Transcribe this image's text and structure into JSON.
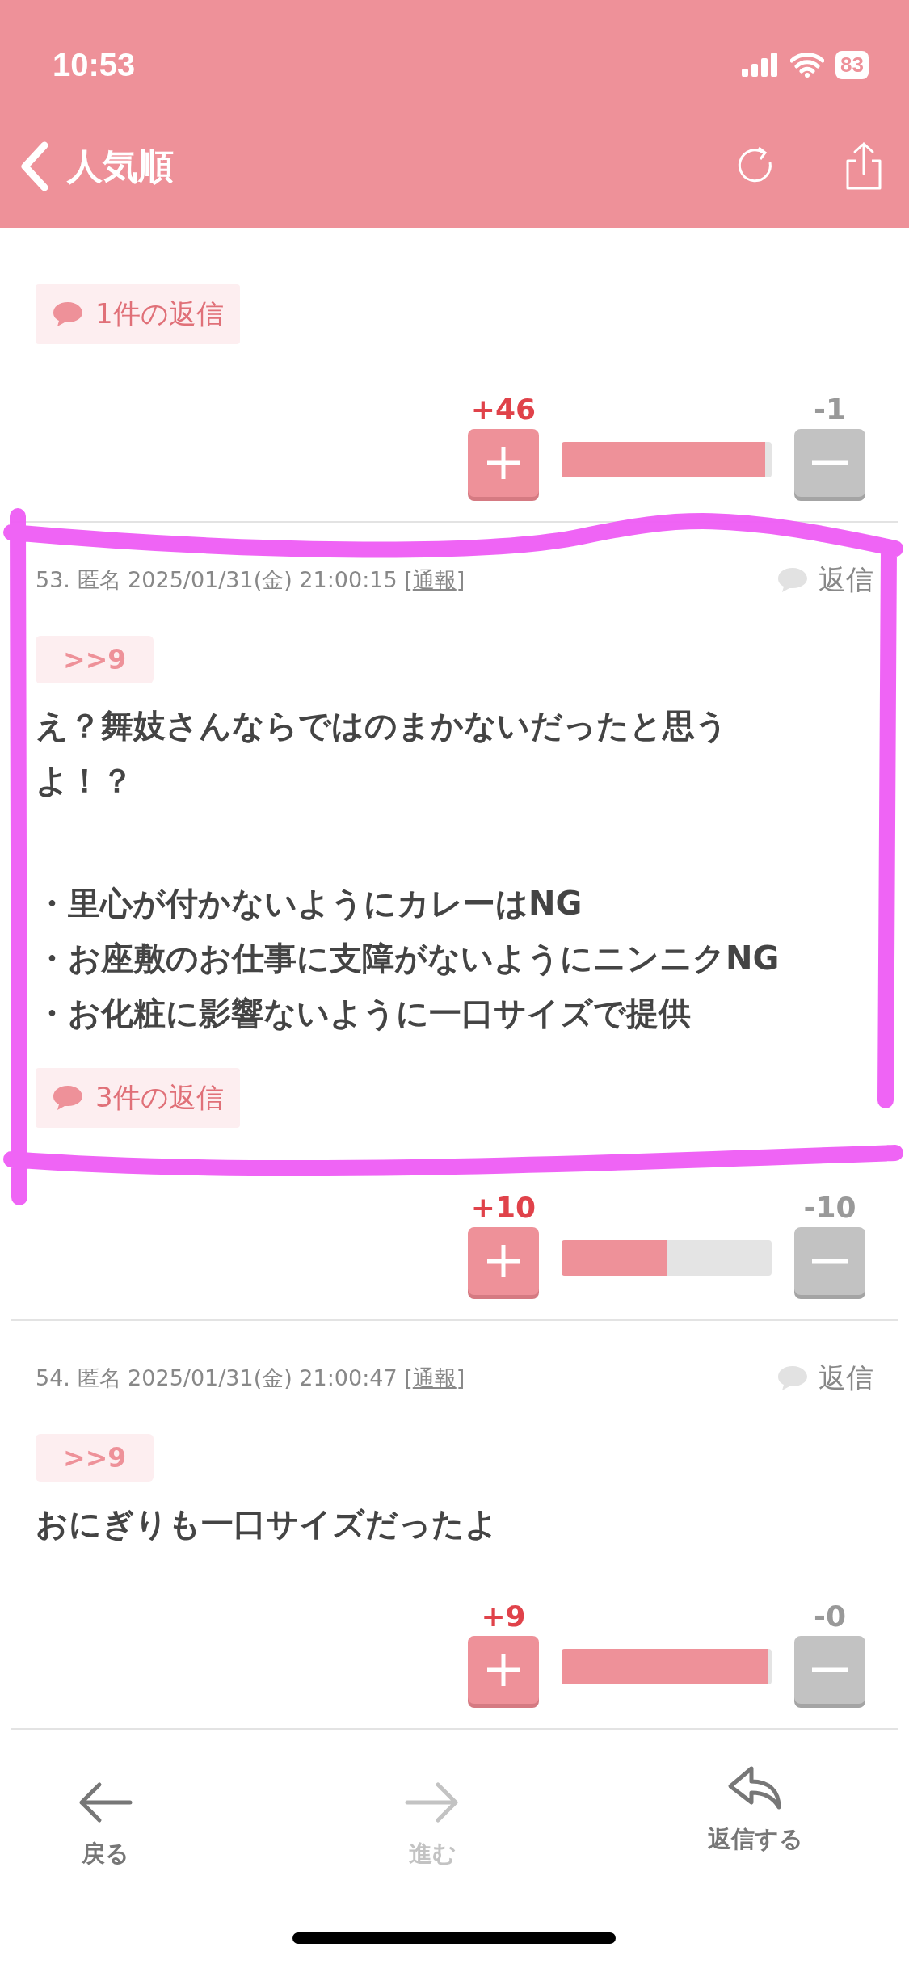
{
  "status_bar": {
    "time": "10:53",
    "battery": "83"
  },
  "nav": {
    "back_label": "人気順"
  },
  "top_comment": {
    "replies": "1件の返信",
    "vote": {
      "plus": "+46",
      "minus": "-1",
      "level": 0.97
    }
  },
  "comments": [
    {
      "meta": "53. 匿名 2025/01/31(金) 21:00:15 [",
      "report": "通報",
      "meta_end": "]",
      "reply": "返信",
      "anchor": ">>9",
      "paragraphs": [
        [
          "え？舞妓さんならではのまかないだったと思うよ！？"
        ],
        [
          "・里心が付かないようにカレーはNG",
          "・お座敷のお仕事に支障がないようにニンニクNG",
          "・お化粧に影響ないように一口サイズで提供"
        ]
      ],
      "replies": "3件の返信",
      "highlighted": true,
      "vote": {
        "plus": "+10",
        "minus": "-10",
        "level": 0.5
      }
    },
    {
      "meta": "54. 匿名 2025/01/31(金) 21:00:47 [",
      "report": "通報",
      "meta_end": "]",
      "reply": "返信",
      "anchor": ">>9",
      "paragraphs": [
        [
          "おにぎりも一口サイズだったよ"
        ]
      ],
      "highlighted": false,
      "vote": {
        "plus": "+9",
        "minus": "-0",
        "level": 0.98
      }
    }
  ],
  "toolbar": [
    {
      "kind": "back",
      "label": "戻る",
      "disabled": false
    },
    {
      "kind": "forward",
      "label": "進む",
      "disabled": true
    },
    {
      "kind": "reply",
      "label": "返信する",
      "disabled": false
    }
  ]
}
